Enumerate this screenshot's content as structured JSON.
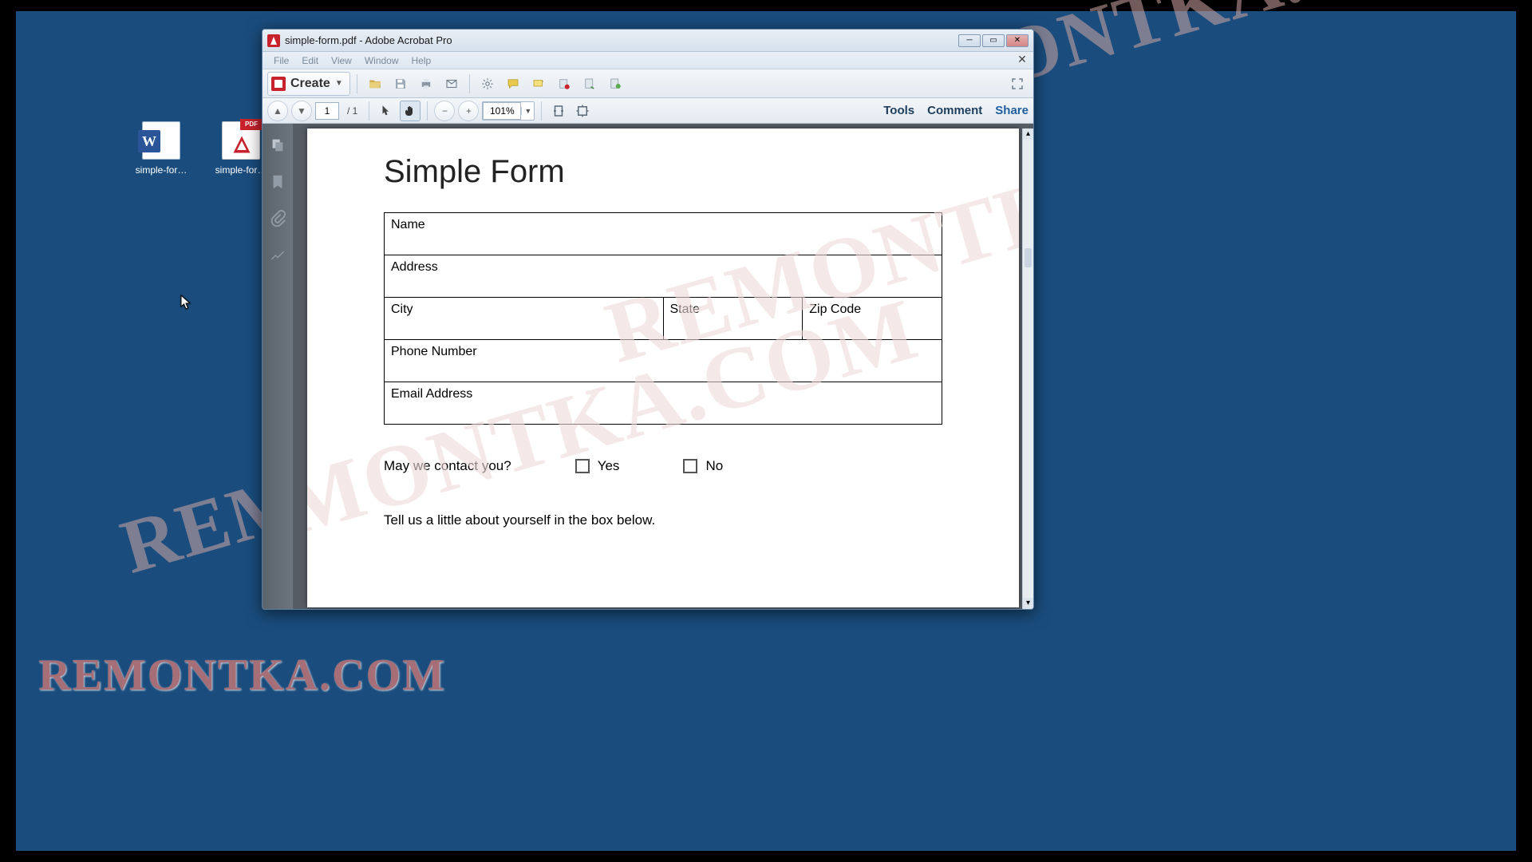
{
  "watermark_text": "REMONTKA.COM",
  "desktop_icons": [
    {
      "name": "word-doc-icon",
      "label": "simple-for…"
    },
    {
      "name": "pdf-doc-icon",
      "label": "simple-for…"
    }
  ],
  "window": {
    "title": "simple-form.pdf - Adobe Acrobat Pro",
    "menus": [
      "File",
      "Edit",
      "View",
      "Window",
      "Help"
    ],
    "create_label": "Create",
    "page_current": "1",
    "page_total": "/ 1",
    "zoom_value": "101%",
    "right_links": {
      "tools": "Tools",
      "comment": "Comment",
      "share": "Share"
    }
  },
  "form": {
    "heading": "Simple Form",
    "fields": {
      "name": "Name",
      "address": "Address",
      "city": "City",
      "state": "State",
      "zip": "Zip Code",
      "phone": "Phone Number",
      "email": "Email Address"
    },
    "contact_q": "May we contact you?",
    "yes": "Yes",
    "no": "No",
    "tell_us": "Tell us a little about yourself in the box below."
  }
}
